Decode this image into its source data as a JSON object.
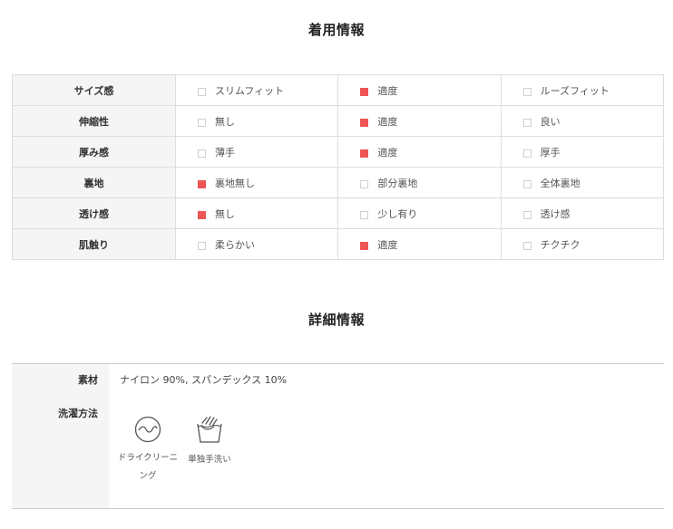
{
  "fit_section": {
    "title": "着用情報",
    "rows": [
      {
        "label": "サイズ感",
        "options": [
          {
            "text": "スリムフィット",
            "checked": false
          },
          {
            "text": "適度",
            "checked": true
          },
          {
            "text": "ルーズフィット",
            "checked": false
          }
        ]
      },
      {
        "label": "伸縮性",
        "options": [
          {
            "text": "無し",
            "checked": false
          },
          {
            "text": "適度",
            "checked": true
          },
          {
            "text": "良い",
            "checked": false
          }
        ]
      },
      {
        "label": "厚み感",
        "options": [
          {
            "text": "薄手",
            "checked": false
          },
          {
            "text": "適度",
            "checked": true
          },
          {
            "text": "厚手",
            "checked": false
          }
        ]
      },
      {
        "label": "裏地",
        "options": [
          {
            "text": "裏地無し",
            "checked": true
          },
          {
            "text": "部分裏地",
            "checked": false
          },
          {
            "text": "全体裏地",
            "checked": false
          }
        ]
      },
      {
        "label": "透け感",
        "options": [
          {
            "text": "無し",
            "checked": true
          },
          {
            "text": "少し有り",
            "checked": false
          },
          {
            "text": "透け感",
            "checked": false
          }
        ]
      },
      {
        "label": "肌触り",
        "options": [
          {
            "text": "柔らかい",
            "checked": false
          },
          {
            "text": "適度",
            "checked": true
          },
          {
            "text": "チクチク",
            "checked": false
          }
        ]
      }
    ],
    "checked_color": "#ee5555"
  },
  "detail_section": {
    "title": "詳細情報",
    "material_label": "素材",
    "material_value": "ナイロン 90%, スパンデックス 10%",
    "washing_label": "洗濯方法",
    "washing_items": [
      {
        "icon": "dry-clean-icon",
        "label_line1": "ドライクリーニ",
        "label_line2": "ング"
      },
      {
        "icon": "hand-wash-icon",
        "label_line1": "単独手洗い",
        "label_line2": ""
      }
    ]
  }
}
